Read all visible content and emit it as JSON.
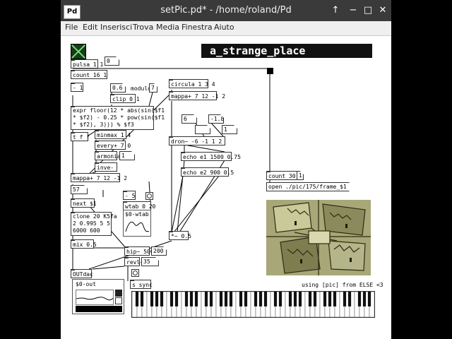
{
  "window": {
    "title": "setPic.pd* - /home/roland/Pd",
    "app_icon": "Pd",
    "buttons": {
      "up": "↑",
      "minimize": "−",
      "maximize": "□",
      "close": "✕"
    }
  },
  "menu": [
    "File",
    "Edit",
    "Inserisci",
    "Trova",
    "Media",
    "Finestra",
    "Aiuto"
  ],
  "patch": {
    "title_comment": "a_strange_place",
    "credit_comment": "using [pic] from ELSE <3",
    "modulo_label": "modulo",
    "wtab_label": "$0-wtab",
    "out_label": "$0-out",
    "objects": {
      "pulsa": "pulsa 1 1",
      "count16": "count 16 1",
      "minus1": "- 1",
      "clip": "clip 0 1",
      "expr": "expr floor(12 * abs(sin($f1\n* $f2) - 0.25 * pow(sin($f1\n* $f2), 3))) % $f3",
      "tff": "t f f",
      "minmax": "minmax 1 4",
      "every": "every+ 7 0",
      "armonia": "armonia",
      "inve": "inve-",
      "mappa1": "mappa+ 7 12 -1 2",
      "next": "next $1",
      "clone": "clone 20 K5fa\n2 0.995 5 5\n6000 600",
      "minus5": "- 5",
      "wtab": "wtab 0 20",
      "mix": "mix 0.5",
      "hip": "hip~ 500",
      "revl": "revl~",
      "outdac": "OUTdac",
      "sync": "s sync",
      "circula": "circula 1 3 4",
      "mappa2": "mappa+ 7 12 -1 2",
      "dron": "dron~ -6 -1 1 2",
      "echo1": "echo e1 1500 0.75",
      "echo2": "echo e2 900 0.5",
      "mul": "*~ 0.5",
      "count30": "count 30 1",
      "open_msg": "open ./pic/175/frame_$1.gif"
    },
    "numbers": {
      "n0": "0",
      "n06": "0.6",
      "n7": "7",
      "n6": "6",
      "nm18": "-1.8",
      "nb": "",
      "n1": "1",
      "nArm": "1",
      "n0b": "0",
      "n57": "57",
      "n200": "200",
      "n35": "35",
      "n1b": "1"
    }
  },
  "colors": {
    "titlebar": "#3a3a3a",
    "toggle_x": "#6ee06e",
    "picture_tint": "#a7a777"
  }
}
